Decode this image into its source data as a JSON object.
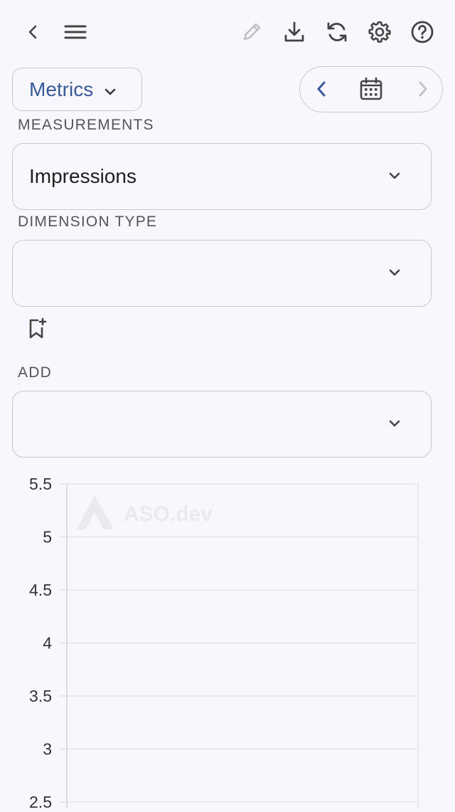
{
  "toolbar": {
    "icons": [
      "back-icon",
      "menu-icon",
      "edit-icon",
      "download-icon",
      "refresh-icon",
      "settings-icon",
      "help-icon"
    ]
  },
  "metrics_button": {
    "label": "Metrics"
  },
  "measurements": {
    "label": "MEASUREMENTS",
    "value": "Impressions"
  },
  "dimension_type": {
    "label": "DIMENSION TYPE",
    "value": ""
  },
  "add": {
    "label": "ADD",
    "value": ""
  },
  "watermark": {
    "text": "ASO.dev"
  },
  "colors": {
    "accent": "#3a5a97",
    "background": "#f8f7fd",
    "border": "#c8c8cc",
    "gridline": "#e3e3e8"
  },
  "chart_data": {
    "type": "line",
    "y_ticks": [
      "5.5",
      "5",
      "4.5",
      "4",
      "3.5",
      "3",
      "2.5"
    ],
    "ylim": [
      2.5,
      5.5
    ],
    "series": [],
    "grid": true
  }
}
